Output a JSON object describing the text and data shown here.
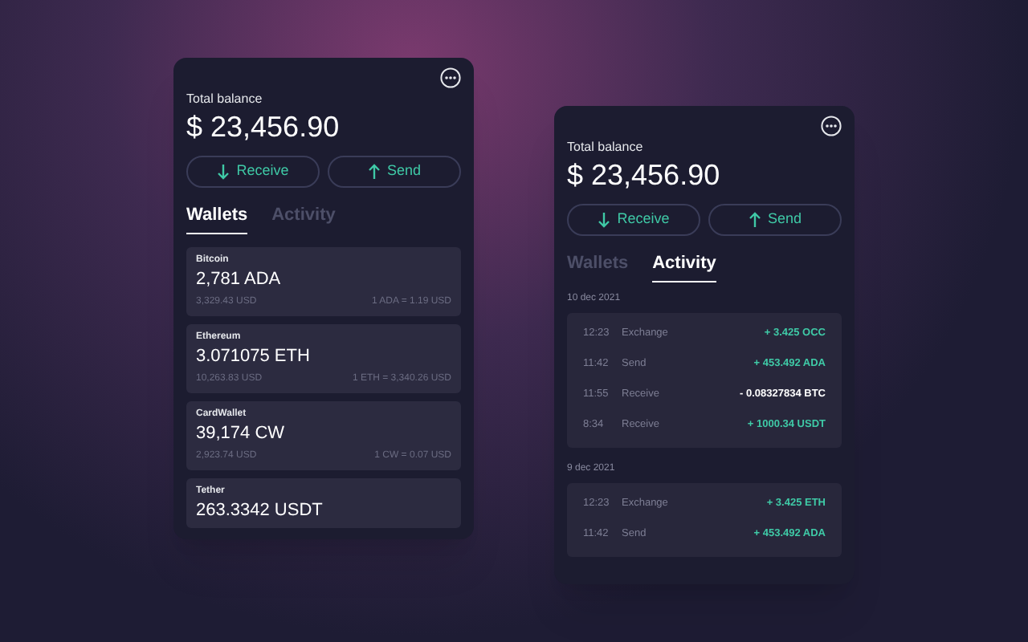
{
  "panels": [
    {
      "kind": "wallets",
      "total_label": "Total balance",
      "balance": "$ 23,456.90",
      "buttons": [
        {
          "kind": "receive",
          "label": "Receive"
        },
        {
          "kind": "send",
          "label": "Send"
        }
      ],
      "tabs": [
        {
          "label": "Wallets",
          "selected": true
        },
        {
          "label": "Activity",
          "selected": false
        }
      ],
      "wallets": [
        {
          "name": "Bitcoin",
          "amount": "2,781 ADA",
          "usd": "3,329.43 USD",
          "rate": "1 ADA = 1.19 USD"
        },
        {
          "name": "Ethereum",
          "amount": "3.071075 ETH",
          "usd": "10,263.83 USD",
          "rate": "1 ETH = 3,340.26 USD"
        },
        {
          "name": "CardWallet",
          "amount": "39,174 CW",
          "usd": "2,923.74 USD",
          "rate": "1 CW = 0.07 USD"
        },
        {
          "name": "Tether",
          "amount": "263.3342 USDT"
        }
      ]
    },
    {
      "kind": "activity",
      "total_label": "Total balance",
      "balance": "$ 23,456.90",
      "buttons": [
        {
          "kind": "receive",
          "label": "Receive"
        },
        {
          "kind": "send",
          "label": "Send"
        }
      ],
      "tabs": [
        {
          "label": "Wallets",
          "selected": false
        },
        {
          "label": "Activity",
          "selected": true
        }
      ],
      "groups": [
        {
          "date": "10 dec 2021",
          "entries": [
            {
              "time": "12:23",
              "type": "Exchange",
              "amount": "+ 3.425 OCC",
              "kind": "credit"
            },
            {
              "time": "11:42",
              "type": "Send",
              "amount": "+ 453.492 ADA",
              "kind": "credit"
            },
            {
              "time": "11:55",
              "type": "Receive",
              "amount": "- 0.08327834 BTC",
              "kind": "debit"
            },
            {
              "time": "8:34",
              "type": "Receive",
              "amount": "+ 1000.34 USDT",
              "kind": "credit"
            }
          ]
        },
        {
          "date": "9 dec 2021",
          "entries": [
            {
              "time": "12:23",
              "type": "Exchange",
              "amount": "+ 3.425 ETH",
              "kind": "credit"
            },
            {
              "time": "11:42",
              "type": "Send",
              "amount": "+ 453.492 ADA",
              "kind": "credit"
            }
          ]
        }
      ]
    }
  ]
}
